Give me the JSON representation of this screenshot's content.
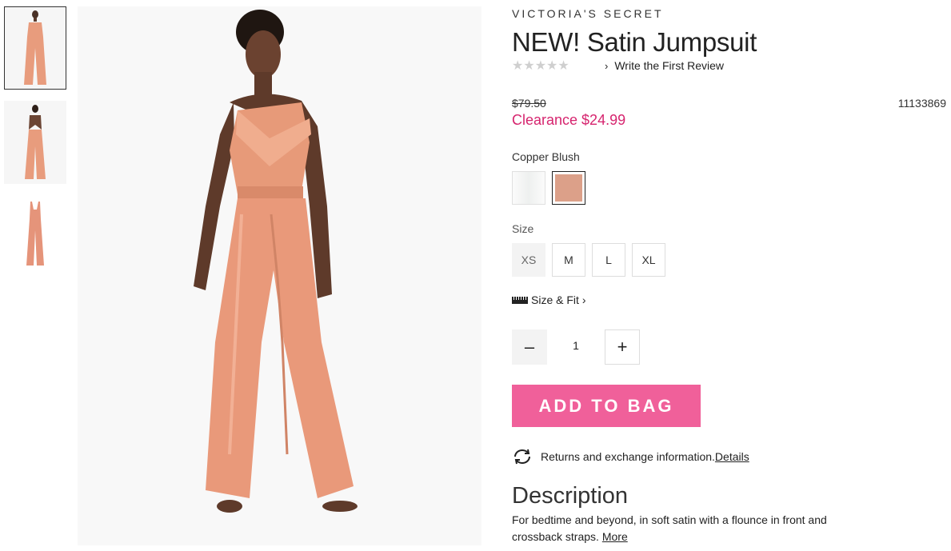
{
  "brand": "VICTORIA'S SECRET",
  "product": {
    "title": "NEW! Satin Jumpsuit",
    "stars": "★★★★★",
    "review_link": "Write the First Review",
    "original_price": "$79.50",
    "sale_price": "Clearance $24.99",
    "sku": "11133869",
    "color_name": "Copper Blush",
    "size_label": "Size",
    "sizes": [
      "XS",
      "M",
      "L",
      "XL"
    ],
    "size_fit": "Size & Fit",
    "quantity": "1",
    "qty_minus": "–",
    "qty_plus": "+",
    "add_to_bag": "ADD TO BAG",
    "returns_text": "Returns and exchange information.",
    "returns_link": "Details",
    "description_heading": "Description",
    "description_text": "For bedtime and beyond, in soft satin with a flounce in front and crossback straps. ",
    "description_more": "More"
  },
  "colors": {
    "accent_pink": "#f0609a",
    "sale_red": "#d6246e",
    "swatch_blush": "#dca089"
  },
  "icons": [
    "chevron-right-icon",
    "ruler-icon",
    "exchange-icon"
  ]
}
